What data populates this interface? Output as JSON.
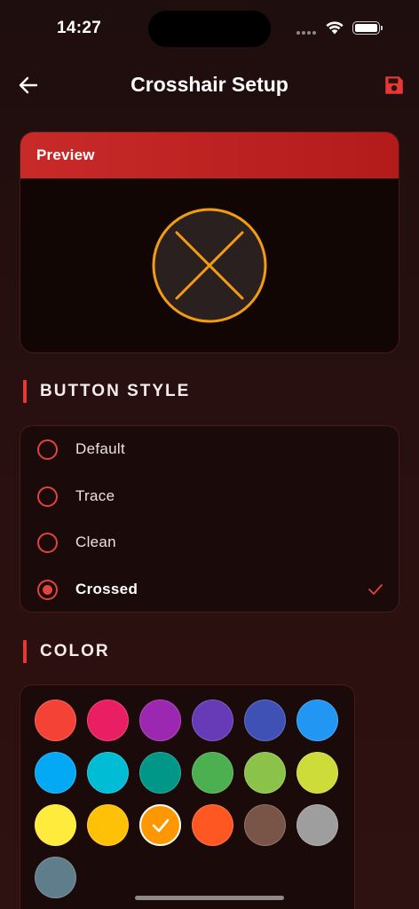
{
  "status": {
    "time": "14:27"
  },
  "appbar": {
    "title": "Crosshair Setup"
  },
  "preview": {
    "title": "Preview",
    "ring_color": "#f39c12",
    "fill_color": "#2a2020"
  },
  "button_style": {
    "heading": "BUTTON STYLE",
    "options": [
      {
        "label": "Default",
        "selected": false
      },
      {
        "label": "Trace",
        "selected": false
      },
      {
        "label": "Clean",
        "selected": false
      },
      {
        "label": "Crossed",
        "selected": true
      }
    ]
  },
  "color": {
    "heading": "COLOR",
    "swatches": [
      {
        "hex": "#f44336",
        "selected": false
      },
      {
        "hex": "#e91e63",
        "selected": false
      },
      {
        "hex": "#9c27b0",
        "selected": false
      },
      {
        "hex": "#673ab7",
        "selected": false
      },
      {
        "hex": "#3f51b5",
        "selected": false
      },
      {
        "hex": "#2196f3",
        "selected": false
      },
      {
        "hex": "#03a9f4",
        "selected": false
      },
      {
        "hex": "#00bcd4",
        "selected": false
      },
      {
        "hex": "#009688",
        "selected": false
      },
      {
        "hex": "#4caf50",
        "selected": false
      },
      {
        "hex": "#8bc34a",
        "selected": false
      },
      {
        "hex": "#cddc39",
        "selected": false
      },
      {
        "hex": "#ffeb3b",
        "selected": false
      },
      {
        "hex": "#ffc107",
        "selected": false
      },
      {
        "hex": "#ff9800",
        "selected": true
      },
      {
        "hex": "#ff5722",
        "selected": false
      },
      {
        "hex": "#795548",
        "selected": false
      },
      {
        "hex": "#9e9e9e",
        "selected": false
      },
      {
        "hex": "#607d8b",
        "selected": false
      }
    ]
  },
  "colors": {
    "accent": "#e53935",
    "header_red": "#c62828"
  }
}
